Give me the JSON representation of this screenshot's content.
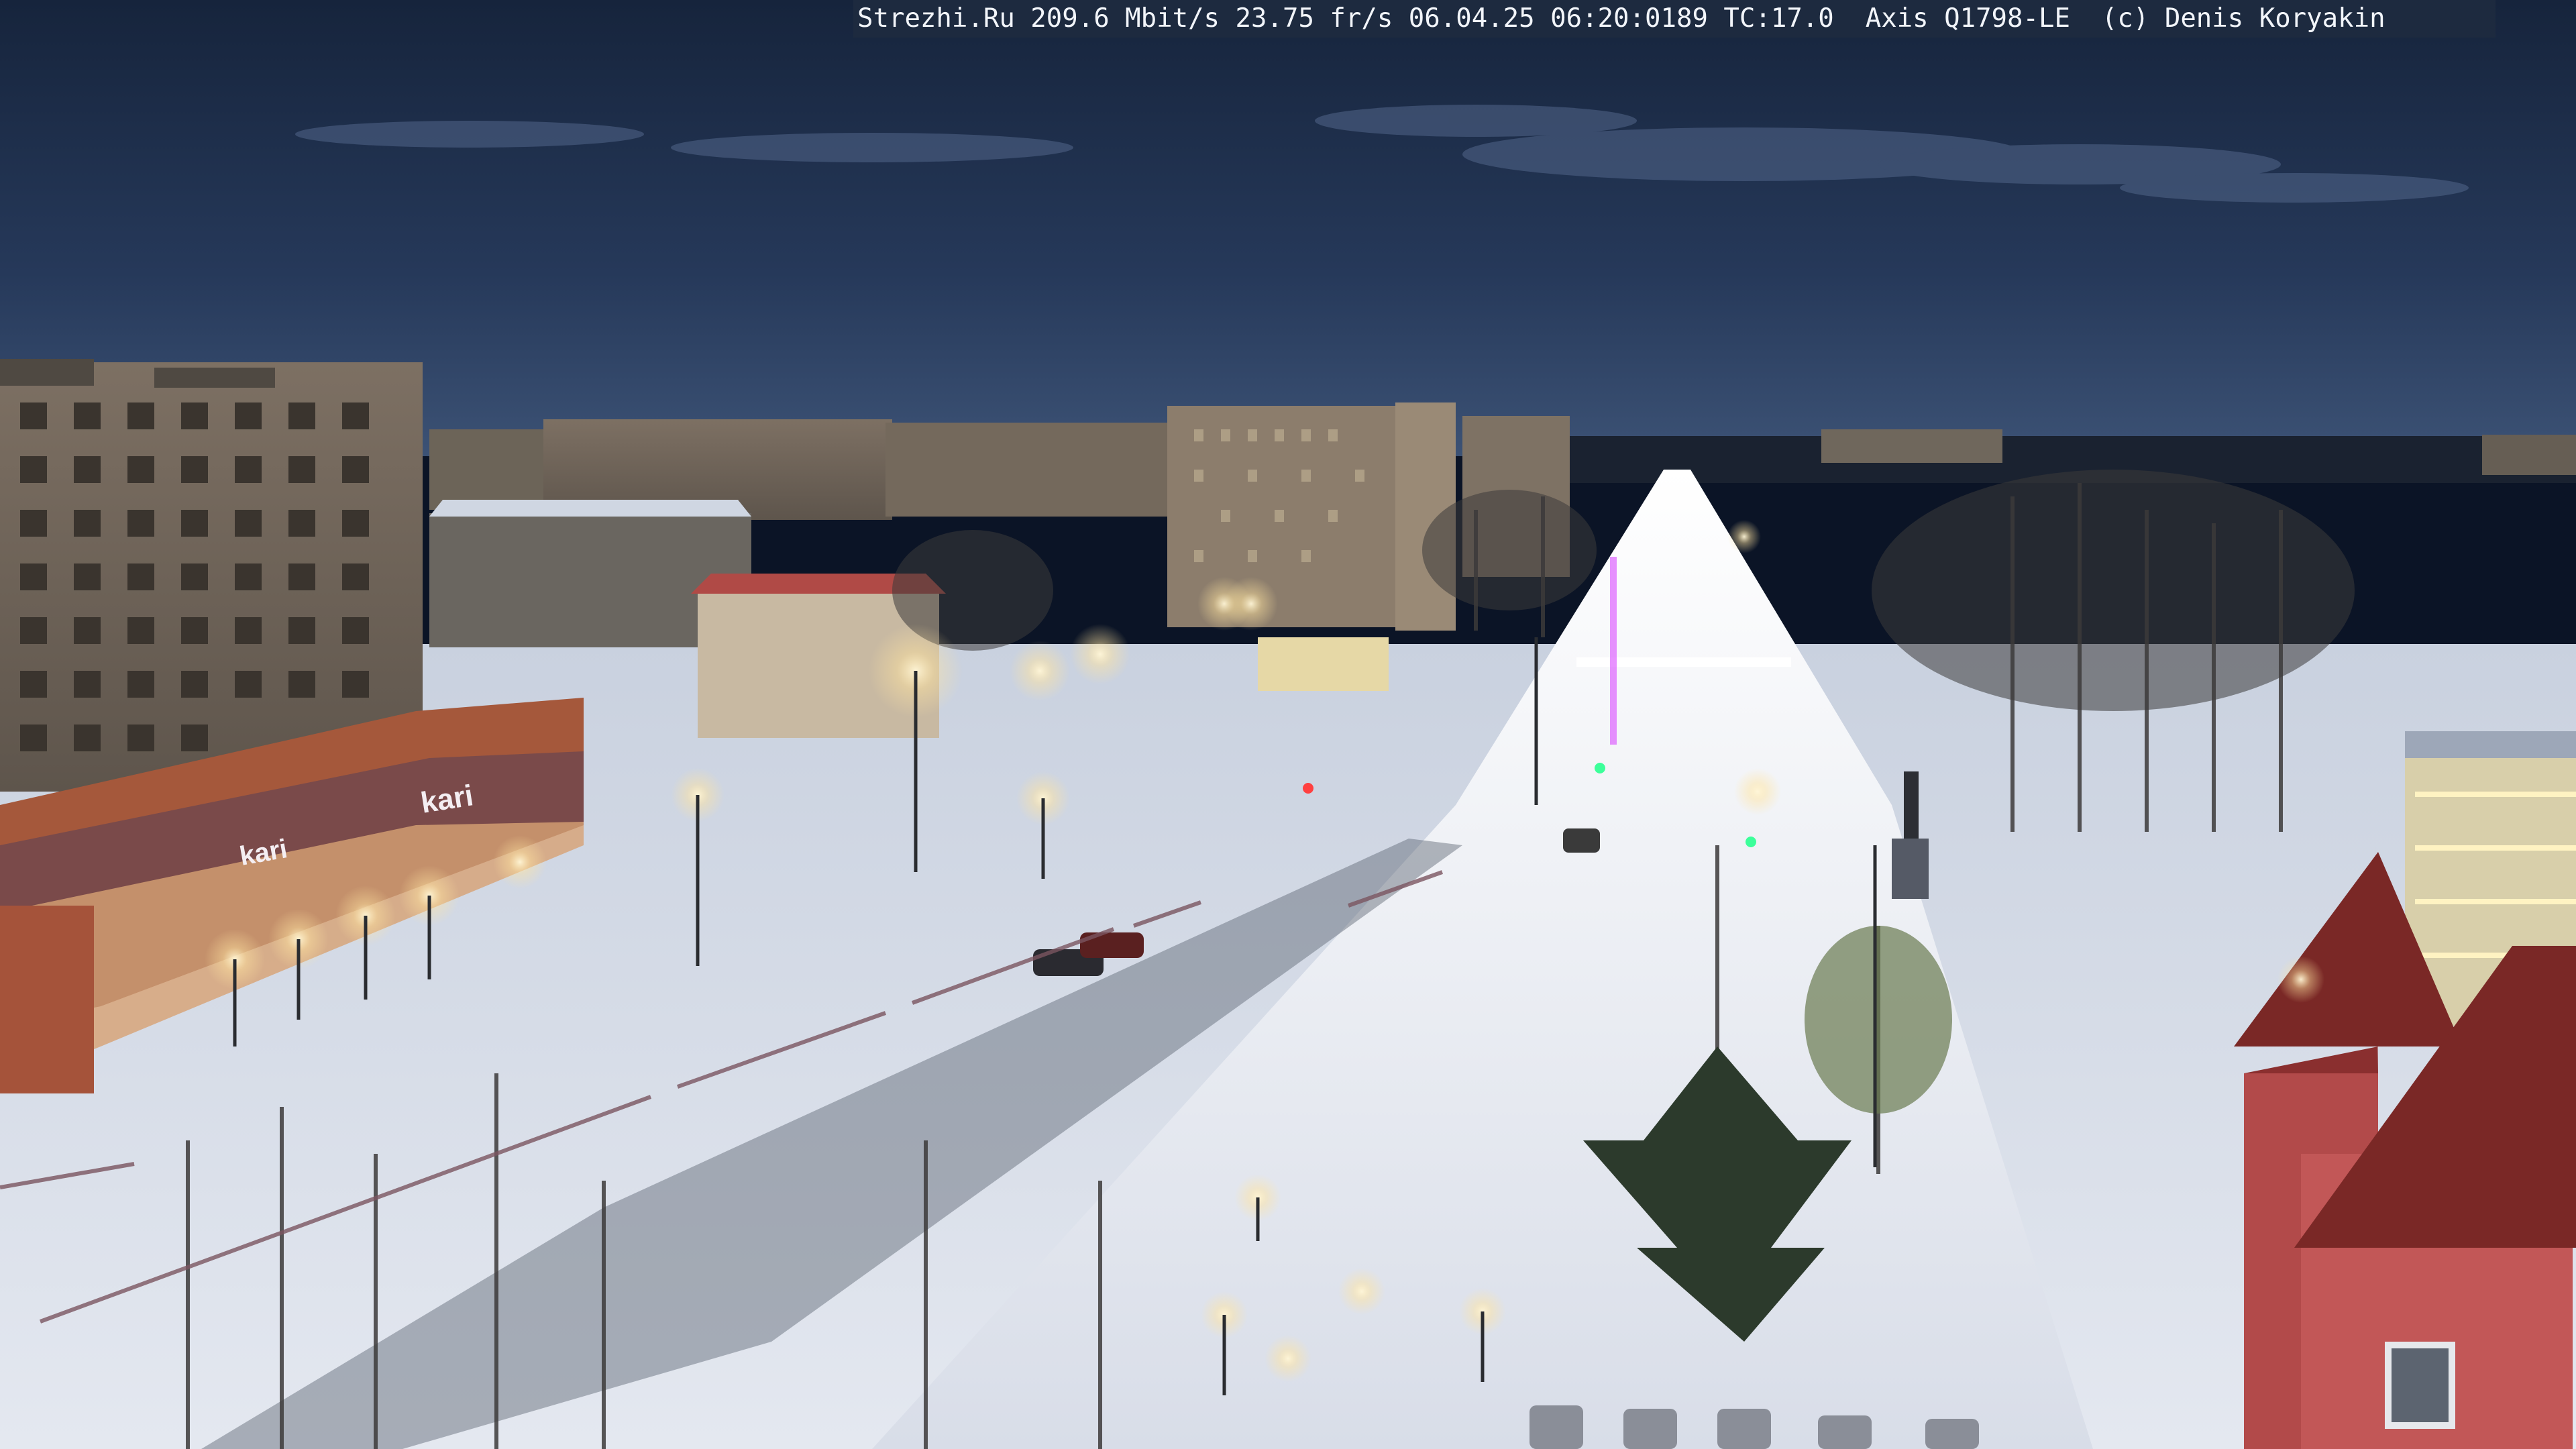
{
  "overlay": {
    "text": "Strezhi.Ru 209.6 Mbit/s 23.75 fr/s 06.04.25 06:20:0189 TC:17.0  Axis Q1798-LE  (c) Denis Koryakin"
  },
  "signage": {
    "store_sign": "kari",
    "store_sign_small": "kari"
  },
  "palette": {
    "sky_top": "#1c2c48",
    "sky_horizon": "#3b4f72",
    "snow": "#dde3ee",
    "road_glow": "#f4f6fb",
    "building": "#8a7a6c",
    "storefront": "#a0563a",
    "tower_red": "#b0484a",
    "street_light": "#ffe9b8"
  }
}
